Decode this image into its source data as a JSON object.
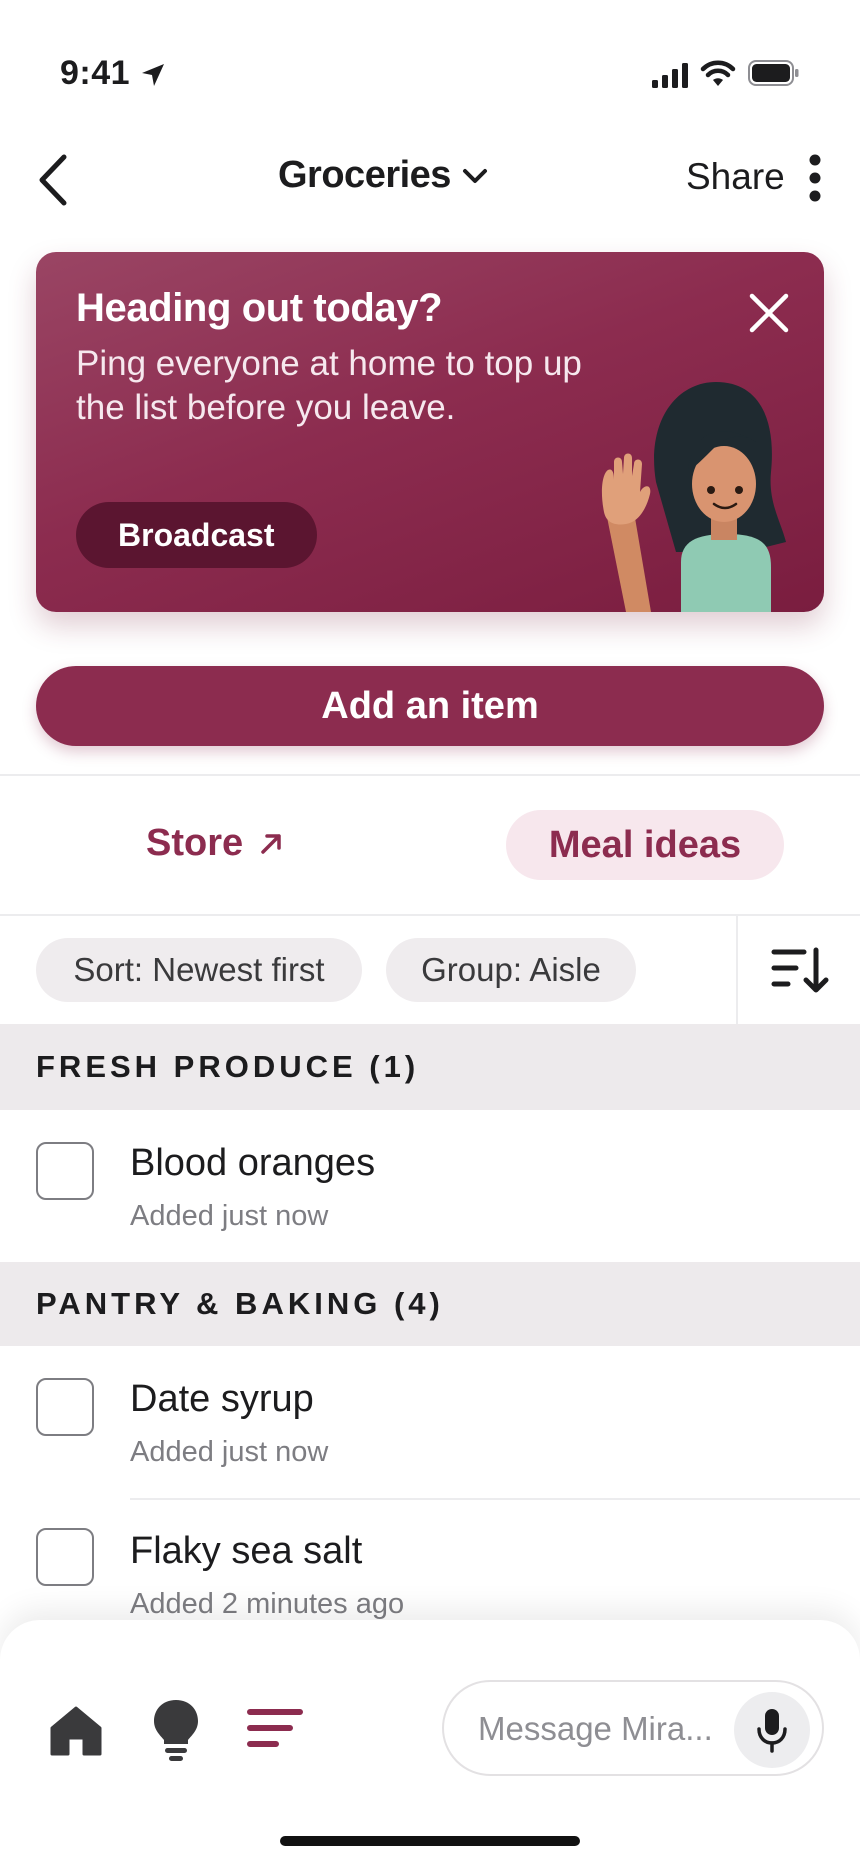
{
  "status_bar": {
    "time": "9:41"
  },
  "header": {
    "title": "Groceries",
    "share_label": "Share"
  },
  "promo": {
    "title": "Heading out today?",
    "body": "Ping everyone at home to top up the list before you leave.",
    "button_label": "Broadcast"
  },
  "add_item_label": "Add an item",
  "tabs": {
    "store_label": "Store",
    "meal_ideas_label": "Meal ideas"
  },
  "filters": {
    "sort_label": "Sort: Newest first",
    "group_label": "Group: Aisle"
  },
  "sections": [
    {
      "title": "FRESH PRODUCE (1)",
      "items": [
        {
          "name": "Blood oranges",
          "added": "Added just now"
        }
      ]
    },
    {
      "title": "PANTRY & BAKING (4)",
      "items": [
        {
          "name": "Date syrup",
          "added": "Added just now"
        },
        {
          "name": "Flaky sea salt",
          "added": "Added 2 minutes ago"
        }
      ]
    }
  ],
  "composer": {
    "placeholder": "Message Mira..."
  },
  "colors": {
    "accent": "#8c2c4f",
    "accent_light": "#f7e7ed",
    "section_bg": "#edeaec"
  }
}
